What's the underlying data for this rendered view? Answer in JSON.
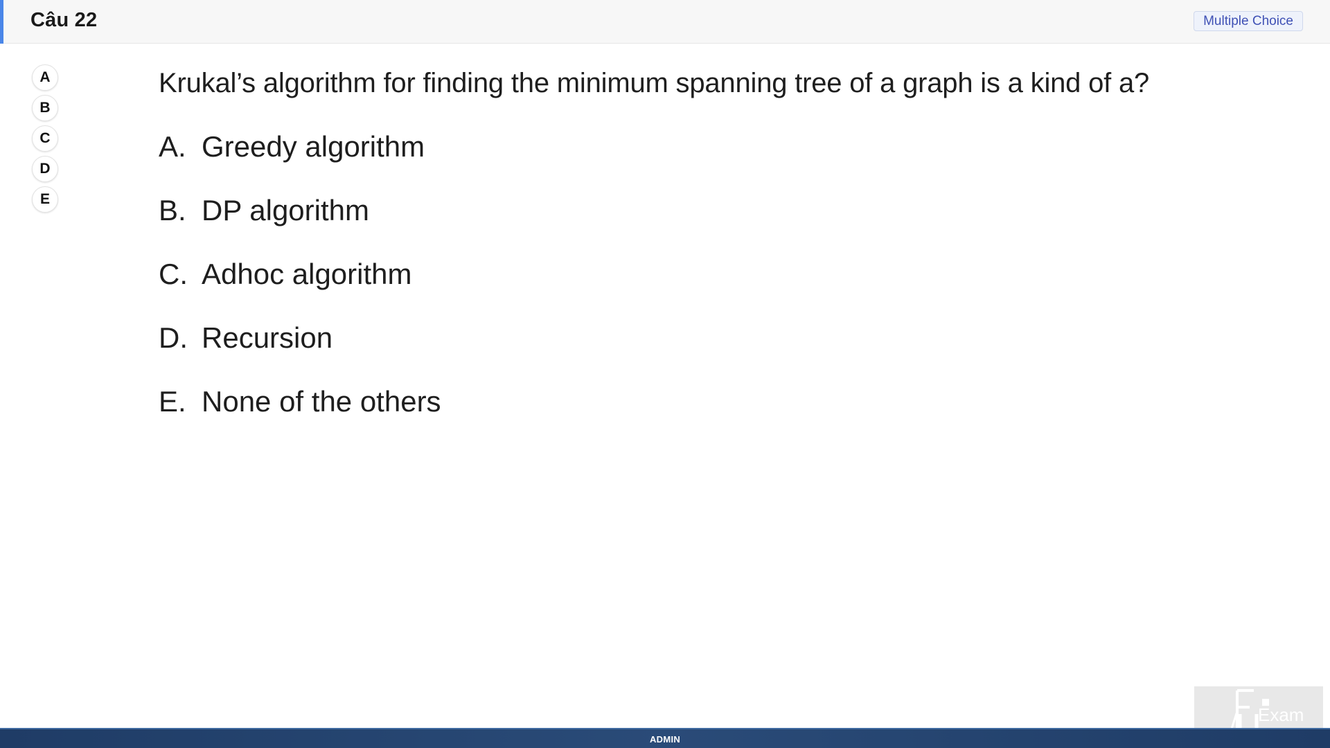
{
  "header": {
    "question_number": "Câu 22",
    "question_type": "Multiple Choice"
  },
  "answer_selector": [
    "A",
    "B",
    "C",
    "D",
    "E"
  ],
  "question": {
    "text": "Krukal’s algorithm for finding the minimum spanning tree of a graph is a kind of a?",
    "options": [
      {
        "letter": "A.",
        "text": "Greedy algorithm"
      },
      {
        "letter": "B.",
        "text": "DP algorithm"
      },
      {
        "letter": "C.",
        "text": "Adhoc algorithm"
      },
      {
        "letter": "D.",
        "text": "Recursion"
      },
      {
        "letter": "E.",
        "text": "None of the others"
      }
    ]
  },
  "footer": {
    "label": "ADMIN"
  },
  "logo": {
    "text": "Exam",
    "icon": "fu-exam-logo"
  },
  "colors": {
    "accent": "#4a86e8",
    "badge_text": "#3f51b5",
    "footer_bg": "#1f3c66"
  }
}
